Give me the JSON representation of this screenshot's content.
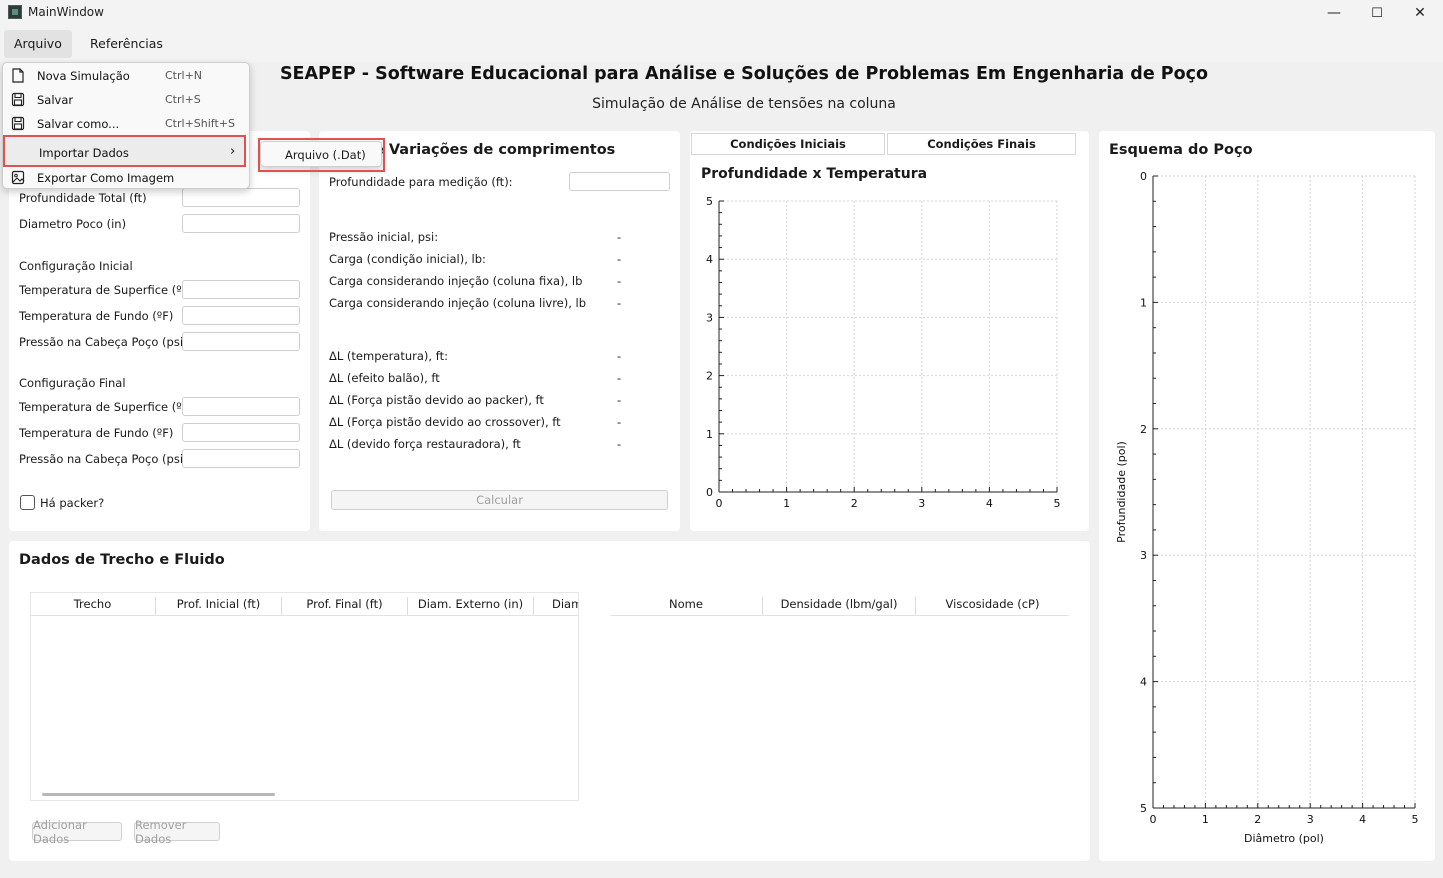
{
  "window": {
    "title": "MainWindow",
    "minimize": "—",
    "maximize": "☐",
    "close": "✕"
  },
  "menubar": {
    "items": [
      "Arquivo",
      "Referências"
    ]
  },
  "dropdown": {
    "items": [
      {
        "label": "Nova Simulação",
        "shortcut": "Ctrl+N",
        "icon": "new-file-icon"
      },
      {
        "label": "Salvar",
        "shortcut": "Ctrl+S",
        "icon": "floppy-disk-icon"
      },
      {
        "label": "Salvar como...",
        "shortcut": "Ctrl+Shift+S",
        "icon": "floppy-disk-icon"
      },
      {
        "label": "Importar Dados",
        "shortcut": "",
        "icon": "",
        "submenu_arrow": "›"
      },
      {
        "label": "Exportar Como Imagem",
        "shortcut": "",
        "icon": "image-icon"
      }
    ],
    "submenu": {
      "label": "Arquivo (.Dat)"
    }
  },
  "header": {
    "title": "SEAPEP - Software Educacional para Análise e Soluções de Problemas Em Engenharia de Poço",
    "subtitle": "Simulação de Análise de tensões na coluna"
  },
  "left_panel": {
    "fields_top": [
      {
        "label": "Profundidade Total (ft)",
        "value": ""
      },
      {
        "label": "Diametro Poco (in)",
        "value": ""
      }
    ],
    "initial": {
      "heading": "Configuração Inicial",
      "fields": [
        {
          "label": "Temperatura de Superfice (ºF)",
          "value": ""
        },
        {
          "label": "Temperatura de Fundo (ºF)",
          "value": ""
        },
        {
          "label": "Pressão na Cabeça Poço (psi)",
          "value": ""
        }
      ]
    },
    "final": {
      "heading": "Configuração Final",
      "fields": [
        {
          "label": "Temperatura de Superfice (ºF)",
          "value": ""
        },
        {
          "label": "Temperatura de Fundo (ºF)",
          "value": ""
        },
        {
          "label": "Pressão na Cabeça Poço (psi)",
          "value": ""
        }
      ]
    },
    "packer_label": "Há packer?",
    "packer_checked": false
  },
  "mid_panel": {
    "title": "e Variações de comprimentos",
    "depth_label": "Profundidade para medição (ft):",
    "depth_value": "",
    "results": [
      {
        "label": "Pressão inicial, psi:",
        "value": "-"
      },
      {
        "label": "Carga (condição inicial), lb:",
        "value": "-"
      },
      {
        "label": "Carga considerando injeção (coluna fixa), lb",
        "value": "-"
      },
      {
        "label": "Carga considerando injeção (coluna livre), lb",
        "value": "-"
      }
    ],
    "deltas": [
      {
        "label": "ΔL (temperatura), ft:",
        "value": "-"
      },
      {
        "label": "ΔL (efeito balão), ft",
        "value": "-"
      },
      {
        "label": "ΔL (Força pistão devido ao packer), ft",
        "value": "-"
      },
      {
        "label": "ΔL (Força pistão devido ao crossover), ft",
        "value": "-"
      },
      {
        "label": "ΔL (devido força restauradora), ft",
        "value": "-"
      }
    ],
    "calc_button": "Calcular"
  },
  "temp_chart": {
    "tabs": [
      "Condições Iniciais",
      "Condições Finais"
    ],
    "title": "Profundidade x Temperatura"
  },
  "well_chart": {
    "title": "Esquema do Poço"
  },
  "bottom": {
    "title": "Dados de Trecho e Fluido",
    "trecho_columns": [
      "Trecho",
      "Prof. Inicial (ft)",
      "Prof. Final (ft)",
      "Diam. Externo (in)",
      "Diam"
    ],
    "fluid_columns": [
      "Nome",
      "Densidade (lbm/gal)",
      "Viscosidade (cP)"
    ],
    "add_button": "Adicionar Dados",
    "remove_button": "Remover Dados"
  },
  "chart_data": [
    {
      "type": "line",
      "title": "Profundidade x Temperatura",
      "xlabel": "",
      "ylabel": "",
      "xlim": [
        0,
        5
      ],
      "ylim": [
        0,
        5
      ],
      "xticks": [
        0,
        1,
        2,
        3,
        4,
        5
      ],
      "yticks": [
        0,
        1,
        2,
        3,
        4,
        5
      ],
      "grid": true,
      "series": []
    },
    {
      "type": "line",
      "title": "",
      "xlabel": "Diâmetro (pol)",
      "ylabel": "Profundidade (pol)",
      "xlim": [
        0,
        5
      ],
      "ylim": [
        0,
        5
      ],
      "y_inverted": true,
      "xticks": [
        0,
        1,
        2,
        3,
        4,
        5
      ],
      "yticks": [
        0,
        1,
        2,
        3,
        4,
        5
      ],
      "grid": true,
      "series": []
    }
  ]
}
